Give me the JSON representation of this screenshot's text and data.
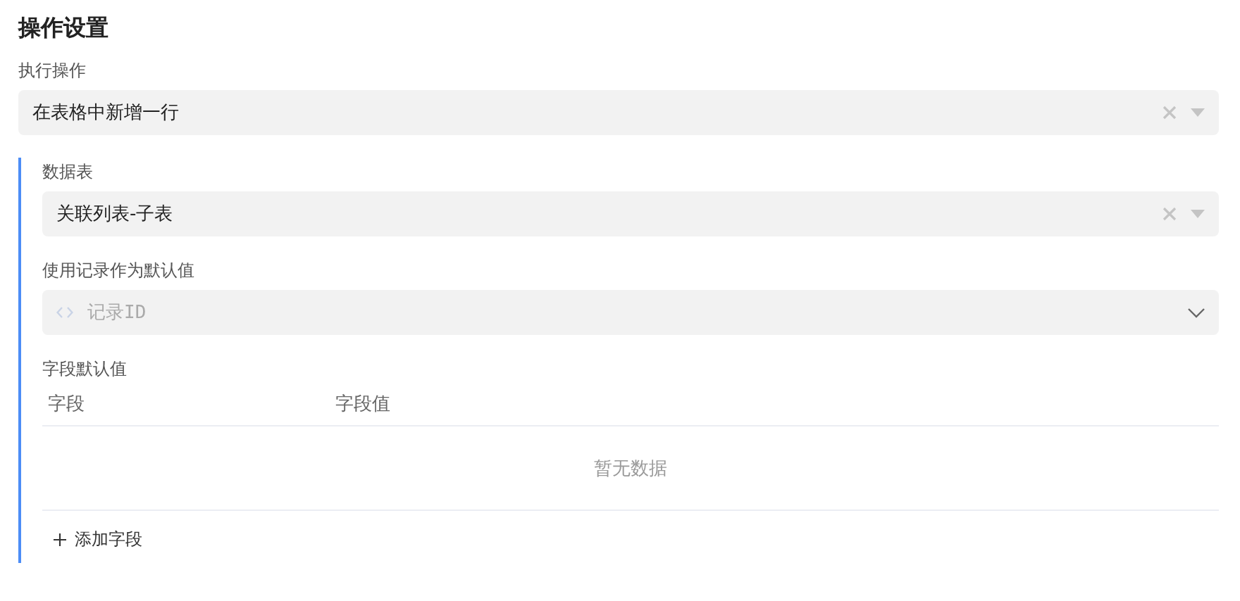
{
  "title": "操作设置",
  "action": {
    "label": "执行操作",
    "value": "在表格中新增一行",
    "clearable": true
  },
  "details": {
    "table_select": {
      "label": "数据表",
      "value": "关联列表-子表",
      "clearable": true
    },
    "record_default": {
      "label": "使用记录作为默认值",
      "placeholder": "记录ID"
    },
    "field_defaults": {
      "label": "字段默认值",
      "columns": [
        "字段",
        "字段值"
      ],
      "empty_text": "暂无数据"
    },
    "add_button": "添加字段"
  }
}
